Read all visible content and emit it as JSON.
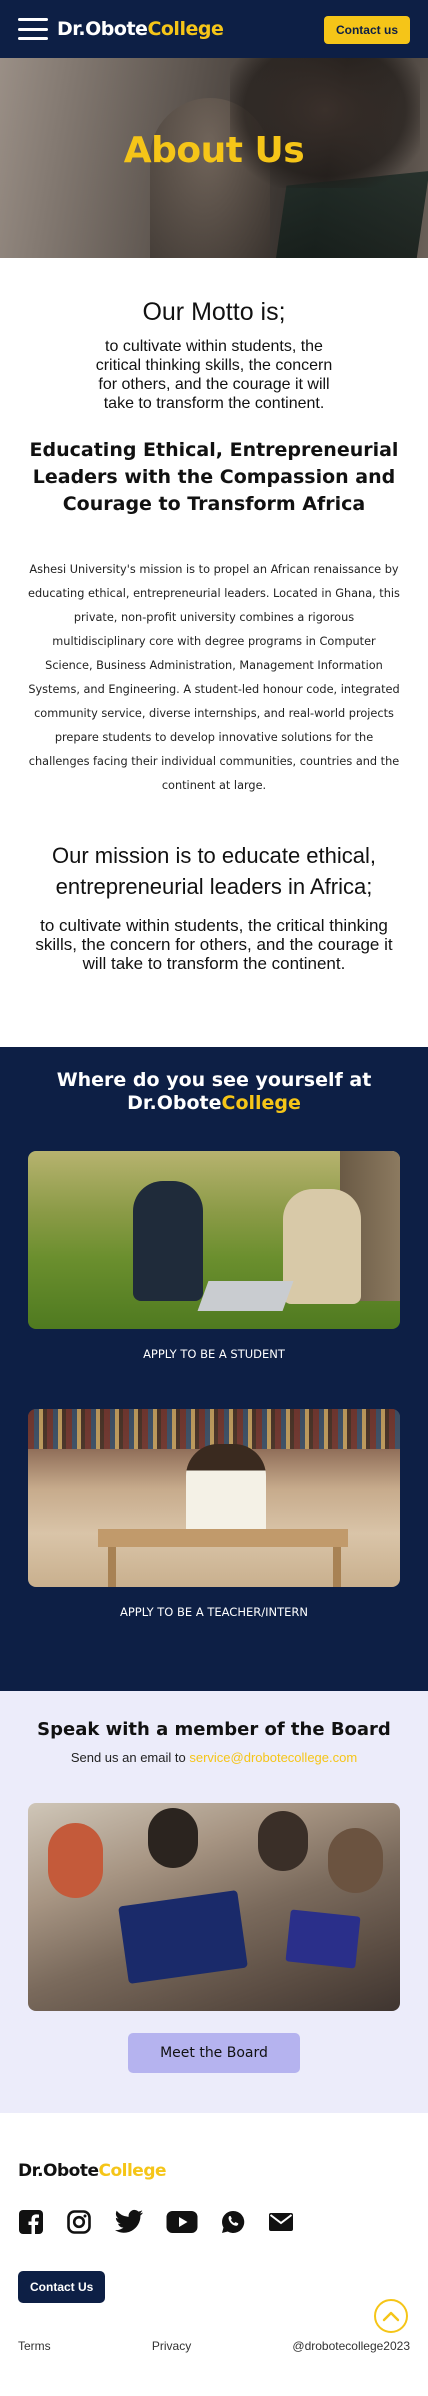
{
  "header": {
    "logo_prefix": "Dr.Obote",
    "logo_suffix": "College",
    "contact_label": "Contact us"
  },
  "hero": {
    "title": "About Us"
  },
  "motto": {
    "heading": "Our Motto is;",
    "text": "to cultivate within students, the critical thinking skills, the concern for others, and the courage it will take to transform the continent.",
    "tagline": "Educating Ethical, Entrepreneurial Leaders with the Compassion and Courage to Transform Africa",
    "body": "Ashesi University's mission is to propel an African renaissance by educating ethical, entrepreneurial leaders. Located in Ghana, this private, non-profit university combines a rigorous multidisciplinary core with degree programs in Computer Science, Business Administration, Management Information Systems, and Engineering. A student-led honour code, integrated community service, diverse internships, and real-world projects prepare students to develop innovative solutions for the challenges facing their individual communities, countries and the continent at large.",
    "mission_heading": "Our mission is to educate ethical, entrepreneurial leaders in Africa;",
    "mission_text": "to cultivate within students, the critical thinking skills, the concern for others, and the courage it will take to transform the continent."
  },
  "where": {
    "heading_prefix": "Where do you see yourself at",
    "heading_name": "Dr.Obote",
    "heading_accent": "College",
    "student_link": "APPLY TO BE A STUDENT",
    "teacher_link": "APPLY TO BE A TEACHER/INTERN"
  },
  "board": {
    "heading": "Speak with a member of the Board",
    "email_prefix": "Send us an email to",
    "email": "service@drobotecollege.com",
    "button": "Meet the Board"
  },
  "footer": {
    "logo_prefix": "Dr.Obote",
    "logo_suffix": "College",
    "socials": [
      "facebook-icon",
      "instagram-icon",
      "twitter-icon",
      "youtube-icon",
      "whatsapp-icon",
      "mail-icon"
    ],
    "contact_label": "Contact Us",
    "terms": "Terms",
    "privacy": "Privacy",
    "handle": "@drobotecollege2023"
  },
  "colors": {
    "navy": "#0d1f45",
    "accent": "#f5c518",
    "board_bg": "#ececfa",
    "button_lavender": "#b5b3ef"
  }
}
